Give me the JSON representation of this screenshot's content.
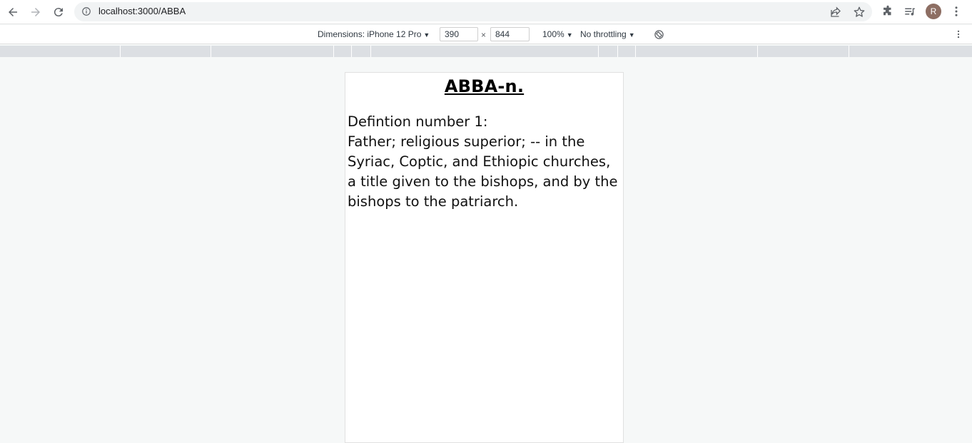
{
  "browser": {
    "url": "localhost:3000/ABBA",
    "profile_initial": "R"
  },
  "device_toolbar": {
    "dimensions_label": "Dimensions: iPhone 12 Pro",
    "width_value": "390",
    "times_symbol": "×",
    "height_value": "844",
    "zoom_label": "100%",
    "throttling_label": "No throttling"
  },
  "page": {
    "title": "ABBA-n.",
    "definition_heading": "Defintion number 1:",
    "definition_text": "Father; religious superior; -- in the Syriac, Coptic, and Ethiopic churches, a title given to the bishops, and by the bishops to the patriarch."
  }
}
